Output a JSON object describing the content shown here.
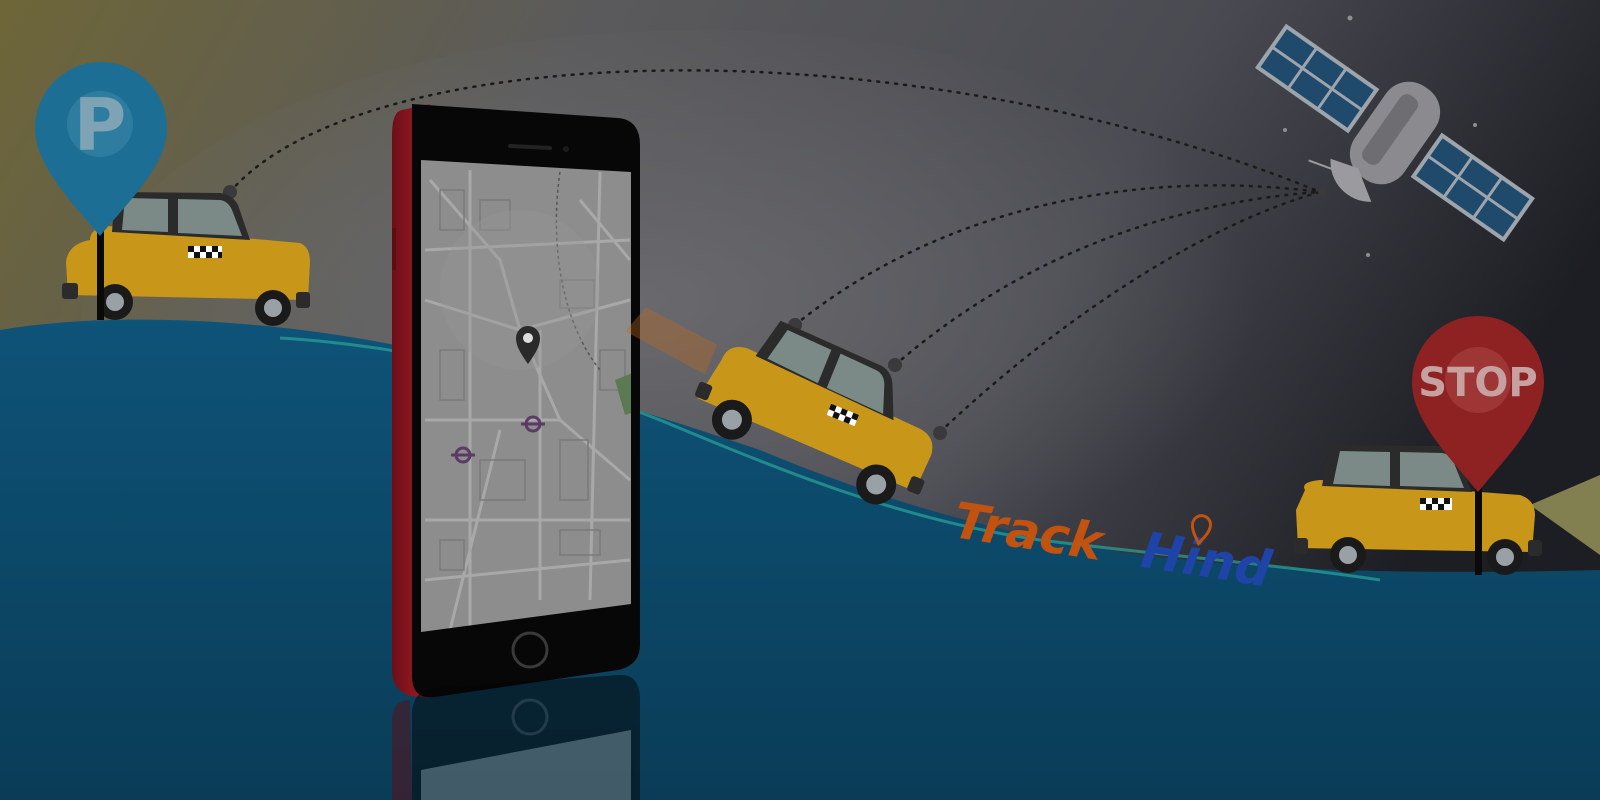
{
  "brand": {
    "part1": "Track",
    "part2": "Hind",
    "part1_color": "#c2520f",
    "part2_color": "#1f44a8"
  },
  "parking_pin": {
    "label": "P",
    "color": "#1d6e95"
  },
  "stop_pin": {
    "label": "STOP",
    "color": "#8e2222"
  },
  "colors": {
    "ground": "#0b4a6a",
    "taxi": "#d39f16",
    "phone_body": "#8f1620",
    "map_bg": "#8a8a8a"
  },
  "icons": [
    "parking-pin-icon",
    "stop-pin-icon",
    "location-marker-icon",
    "satellite-icon",
    "underground-station-icon"
  ]
}
